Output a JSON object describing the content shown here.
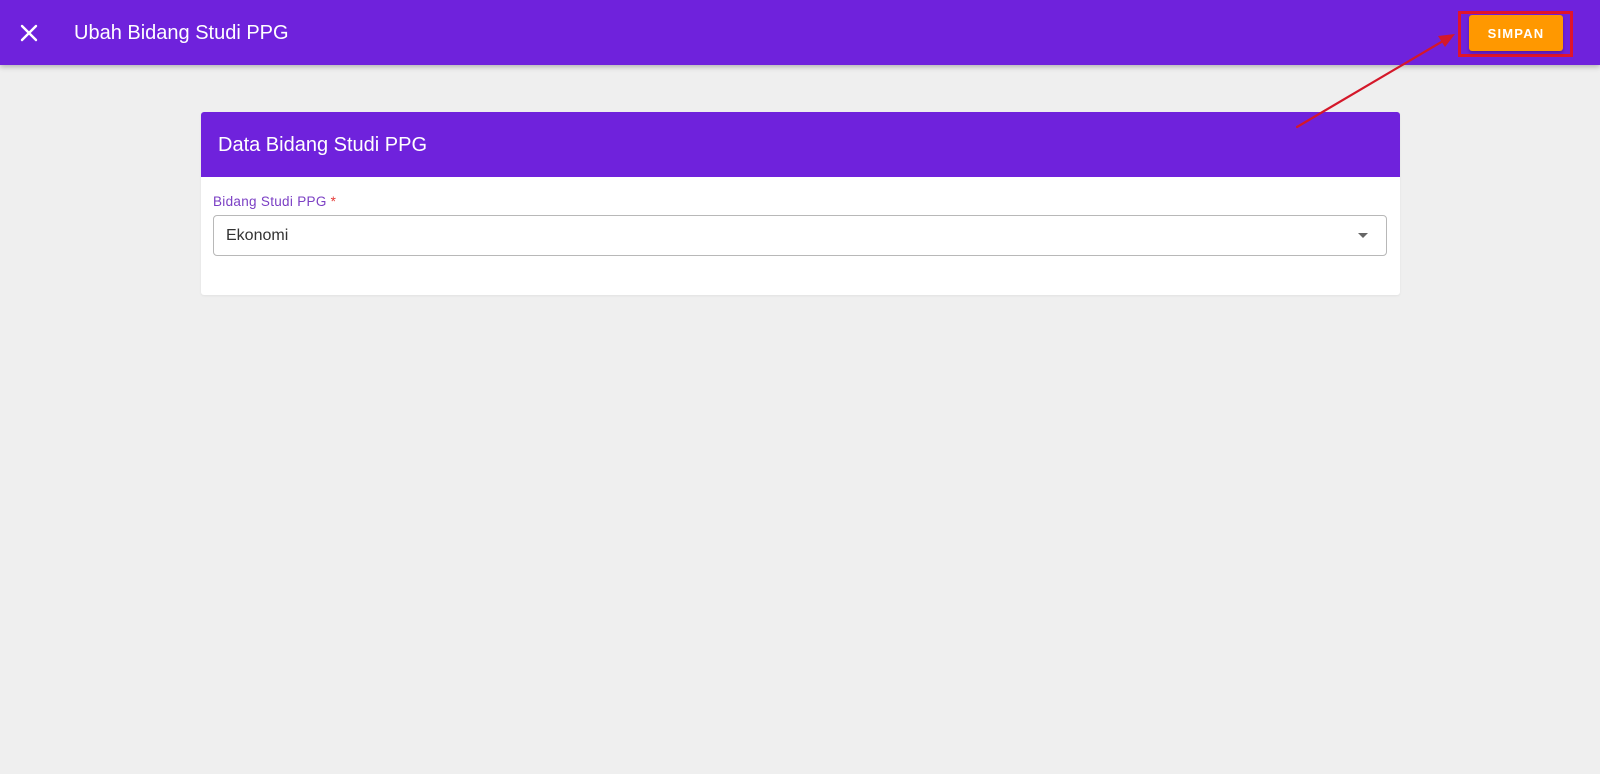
{
  "topbar": {
    "close_icon": "close-icon",
    "title": "Ubah Bidang Studi PPG",
    "save_label": "SIMPAN",
    "background_color": "#6f22dc",
    "save_button_color": "#ff9800",
    "highlight_color": "#e0142c"
  },
  "card": {
    "title": "Data Bidang Studi PPG",
    "field": {
      "label": "Bidang Studi PPG",
      "required_marker": "*",
      "value": "Ekonomi",
      "dropdown_icon": "caret-down-icon"
    }
  },
  "annotation": {
    "arrow_icon": "red-arrow-icon",
    "arrow_color": "#d4182a"
  }
}
